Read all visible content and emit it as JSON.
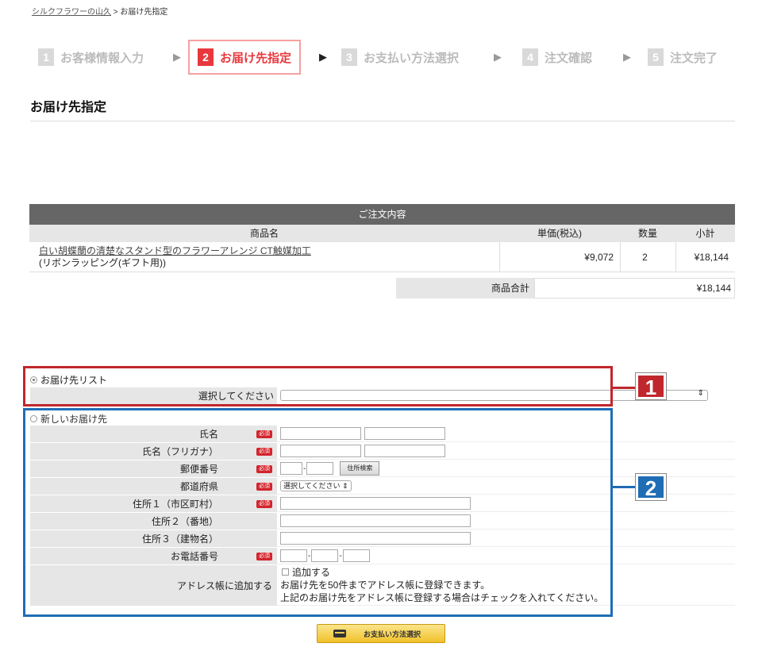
{
  "breadcrumb": {
    "shop": "シルクフラワーの山久",
    "sep": " > ",
    "current": "お届け先指定"
  },
  "steps": [
    {
      "num": "1",
      "label": "お客様情報入力"
    },
    {
      "num": "2",
      "label": "お届け先指定"
    },
    {
      "num": "3",
      "label": "お支払い方法選択"
    },
    {
      "num": "4",
      "label": "注文確認"
    },
    {
      "num": "5",
      "label": "注文完了"
    }
  ],
  "arrow": "▶",
  "page_title": "お届け先指定",
  "order": {
    "heading": "ご注文内容",
    "columns": {
      "name": "商品名",
      "price": "単価(税込)",
      "qty": "数量",
      "subtotal": "小計"
    },
    "item": {
      "name": "白い胡蝶蘭の清楚なスタンド型のフラワーアレンジ CT触媒加工",
      "option": "(リボンラッピング(ギフト用))",
      "price": "¥9,072",
      "qty": "2",
      "subtotal": "¥18,144"
    },
    "total_label": "商品合計",
    "total_value": "¥18,144"
  },
  "annotations": {
    "badge1": "1",
    "badge2": "2"
  },
  "dest_list": {
    "label": "お届け先リスト",
    "select_label": "選択してください"
  },
  "new_dest": {
    "label": "新しいお届け先",
    "required": "必須",
    "fields": {
      "name": "氏名",
      "kana": "氏名（フリガナ）",
      "zip": "郵便番号",
      "zip_button": "住所検索",
      "pref": "都道府県",
      "pref_placeholder": "選択してください",
      "addr1": "住所１（市区町村）",
      "addr2": "住所２（番地）",
      "addr3": "住所３（建物名）",
      "tel": "お電話番号",
      "addrbook": "アドレス帳に追加する",
      "addrbook_check": "追加する",
      "addrbook_note1": "お届け先を50件までアドレス帳に登録できます。",
      "addrbook_note2": "上記のお届け先をアドレス帳に登録する場合はチェックを入れてください。"
    },
    "dash": "-"
  },
  "pay_button": "お支払い方法選択"
}
